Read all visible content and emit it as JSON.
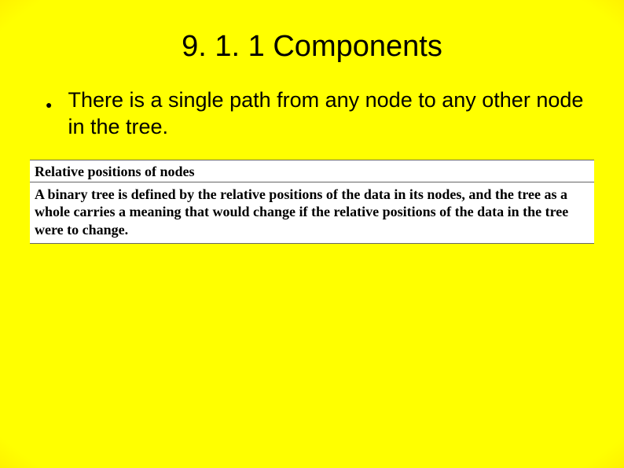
{
  "slide": {
    "title": "9. 1. 1 Components",
    "bullet": "There is a single path from any node to any other node in the tree.",
    "embedded": {
      "header": "Relative positions of nodes",
      "body": "A binary tree is defined by the relative positions of the data in its nodes, and the tree as a whole carries a meaning that would change if the relative positions of the data in the tree were to change."
    }
  }
}
